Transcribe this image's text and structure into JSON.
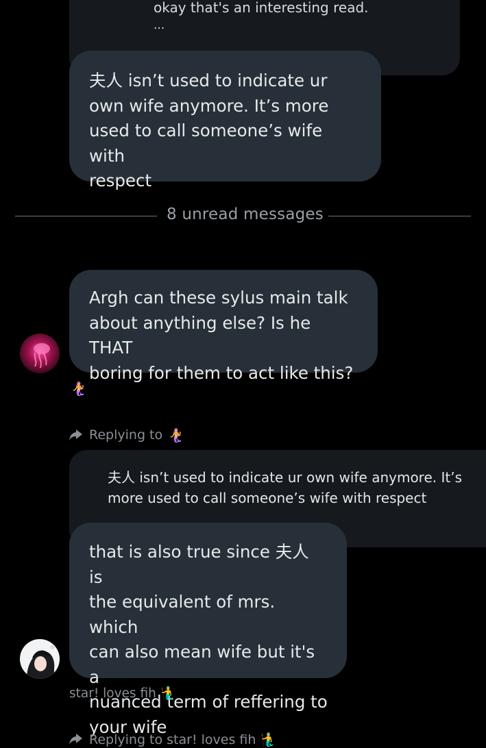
{
  "messages": {
    "m1": {
      "quote_lines": [
        "okay that's an interesting read.",
        "..."
      ],
      "text": "夫人 isn’t used to indicate ur\nown wife anymore. It’s more\nused to call someone’s wife with\nrespect"
    },
    "divider": {
      "label": "8 unread messages"
    },
    "m2": {
      "text": "Argh can these sylus main talk\nabout anything else? Is he THAT\nboring for them to act like this?",
      "sender_emoji": "🧜‍♀️"
    },
    "m3": {
      "replying_label": "Replying to",
      "replying_to_emoji": "🧜‍♀️",
      "quote_text": "夫人 isn’t used to indicate ur own wife anymore. It’s\nmore used to call someone’s wife with respect",
      "text": "that is also true since 夫人 is\nthe equivalent of mrs. which\ncan also mean wife but it's a\nnuanced term of reffering to\nyour wife",
      "sender_name": "star! loves fih 🧜‍♂️"
    },
    "m4": {
      "replying_label": "Replying to star! loves fih 🧜‍♂️"
    }
  },
  "colors": {
    "background": "#000000",
    "bubble": "#273038",
    "quote_bubble": "#16191e",
    "muted_text": "#8b9095"
  },
  "icons": {
    "reply": "reply-arrow-icon",
    "avatar1": "jellyfish-avatar",
    "avatar2": "girl-portrait-avatar"
  }
}
